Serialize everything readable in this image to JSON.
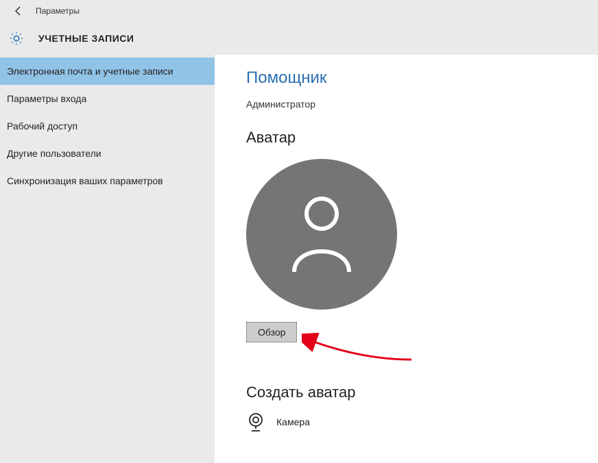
{
  "titlebar": {
    "title": "Параметры"
  },
  "header": {
    "heading": "УЧЕТНЫЕ ЗАПИСИ"
  },
  "sidebar": {
    "items": [
      {
        "label": "Электронная почта и учетные записи",
        "active": true
      },
      {
        "label": "Параметры входа",
        "active": false
      },
      {
        "label": "Рабочий доступ",
        "active": false
      },
      {
        "label": "Другие пользователи",
        "active": false
      },
      {
        "label": "Синхронизация ваших параметров",
        "active": false
      }
    ]
  },
  "main": {
    "username": "Помощник",
    "role": "Администратор",
    "avatar_heading": "Аватар",
    "browse_label": "Обзор",
    "create_heading": "Создать аватар",
    "camera_label": "Камера"
  }
}
